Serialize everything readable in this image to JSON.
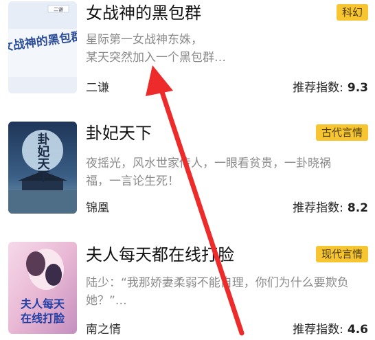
{
  "books": [
    {
      "title": "女战神的黑包群",
      "tag": "科幻",
      "desc_line1": "星际第一女战神东姝，",
      "desc_line2": "某天突然加入一个黑包群…",
      "author": "二谦",
      "score_label": "推荐指数:",
      "score_value": "9.3",
      "cover_text": "女战神的黑包群",
      "cover_small": "二谦"
    },
    {
      "title": "卦妃天下",
      "tag": "古代言情",
      "desc_line1": "夜摇光，风水世家传人，一眼看贫贵，一卦晓祸",
      "desc_line2": "福，一言论生死！",
      "author": "锦凰",
      "score_label": "推荐指数:",
      "score_value": "8.2",
      "cover_text": "卦妃天下"
    },
    {
      "title": "夫人每天都在线打脸",
      "tag": "现代言情",
      "desc_line1": "陆少：“我那娇妻柔弱不能自理，你们为什么要欺负",
      "desc_line2": "她？”…",
      "author": "南之情",
      "score_label": "推荐指数:",
      "score_value": "4.6",
      "cover_text_line1": "夫人每天",
      "cover_text_line2": "在线打脸"
    }
  ],
  "colors": {
    "tag_bg": "#f6c531",
    "arrow": "#ee2b2b",
    "desc": "#8a8a8a"
  }
}
